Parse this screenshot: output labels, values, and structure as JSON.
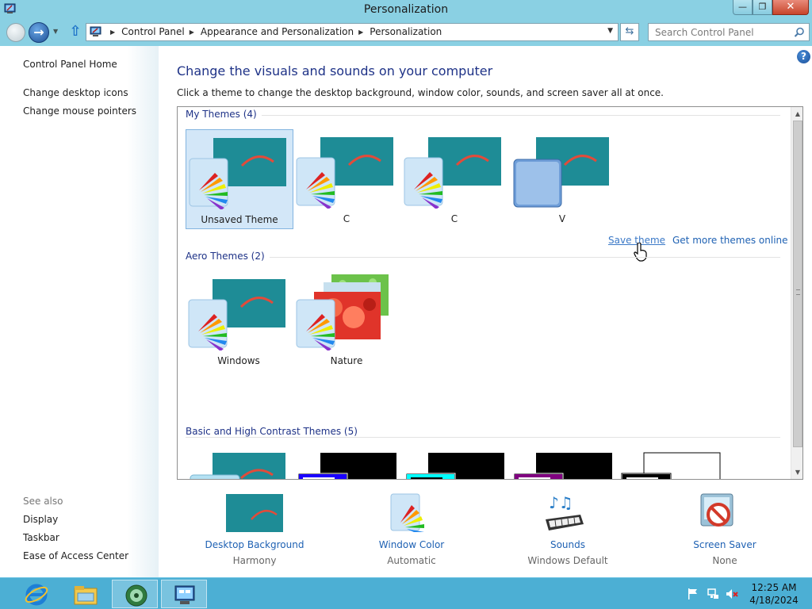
{
  "window": {
    "title": "Personalization"
  },
  "titlebar": {
    "minimize": "—",
    "maximize": "❐",
    "close": "✕"
  },
  "address": {
    "crumbs": [
      "Control Panel",
      "Appearance and Personalization",
      "Personalization"
    ],
    "search_placeholder": "Search Control Panel"
  },
  "sidebar": {
    "home": "Control Panel Home",
    "links": [
      "Change desktop icons",
      "Change mouse pointers"
    ],
    "see_also_label": "See also",
    "see_also": [
      "Display",
      "Taskbar",
      "Ease of Access Center"
    ]
  },
  "main": {
    "title": "Change the visuals and sounds on your computer",
    "subtitle": "Click a theme to change the desktop background, window color, sounds, and screen saver all at once.",
    "help": "?",
    "sections": {
      "my": {
        "heading": "My Themes (4)",
        "themes": [
          "Unsaved Theme",
          "C",
          "C",
          "V"
        ],
        "selected": "Unsaved Theme"
      },
      "aero": {
        "heading": "Aero Themes (2)",
        "themes": [
          "Windows",
          "Nature"
        ]
      },
      "basic": {
        "heading": "Basic and High Contrast Themes (5)"
      }
    },
    "save_theme": "Save theme",
    "more_themes": "Get more themes online"
  },
  "customize": [
    {
      "label": "Desktop Background",
      "value": "Harmony",
      "icon": "desktop-background-icon"
    },
    {
      "label": "Window Color",
      "value": "Automatic",
      "icon": "window-color-icon"
    },
    {
      "label": "Sounds",
      "value": "Windows Default",
      "icon": "sounds-icon"
    },
    {
      "label": "Screen Saver",
      "value": "None",
      "icon": "screen-saver-icon"
    }
  ],
  "taskbar": {
    "time": "12:25 AM",
    "date": "4/18/2024"
  },
  "colors": {
    "accent": "#1e3287",
    "link": "#1e61b3",
    "taskbar": "#4cafd4",
    "titlebar": "#8ad0e3"
  }
}
